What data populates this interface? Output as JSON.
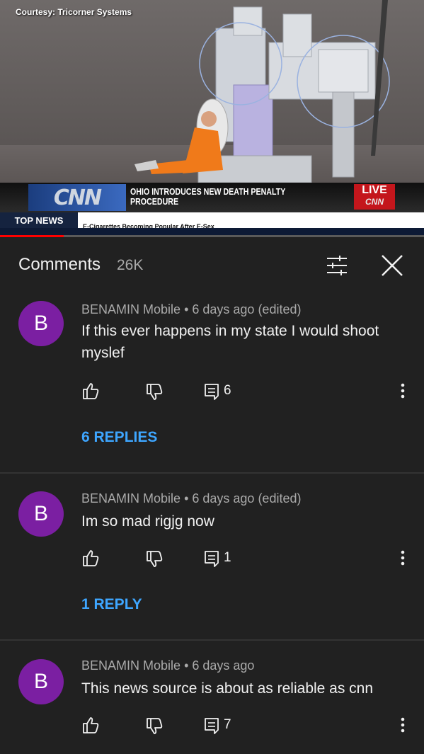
{
  "video": {
    "courtesy": "Courtesy: Tricorner Systems",
    "network_logo": "CNN",
    "headline": "OHIO INTRODUCES NEW DEATH PENALTY PROCEDURE",
    "live_label": "LIVE",
    "live_logo": "CNN",
    "ticker_label": "TOP NEWS",
    "ticker_text": "E-Cigarettes Becoming Popular After E-Sex",
    "progress": 0.15
  },
  "comments_header": {
    "title": "Comments",
    "count": "26K",
    "filter_icon": "filter-sort-icon",
    "close_icon": "close-icon"
  },
  "comments": [
    {
      "avatar_letter": "B",
      "author": "BENAMIN Mobile",
      "time": "6 days ago (edited)",
      "text": "If this ever happens in my state I would shoot myslef",
      "reply_count": "6",
      "replies_link": "6 REPLIES"
    },
    {
      "avatar_letter": "B",
      "author": "BENAMIN Mobile",
      "time": "6 days ago (edited)",
      "text": "Im so mad rigjg now",
      "reply_count": "1",
      "replies_link": "1 REPLY"
    },
    {
      "avatar_letter": "B",
      "author": "BENAMIN Mobile",
      "time": "6 days ago",
      "text": "This news source is about as reliable as cnn",
      "reply_count": "7",
      "replies_link": ""
    }
  ],
  "colors": {
    "background": "#212121",
    "avatar": "#7b1fa2",
    "link": "#3ea6ff",
    "progress": "#ff0000",
    "live": "#c4161c"
  }
}
